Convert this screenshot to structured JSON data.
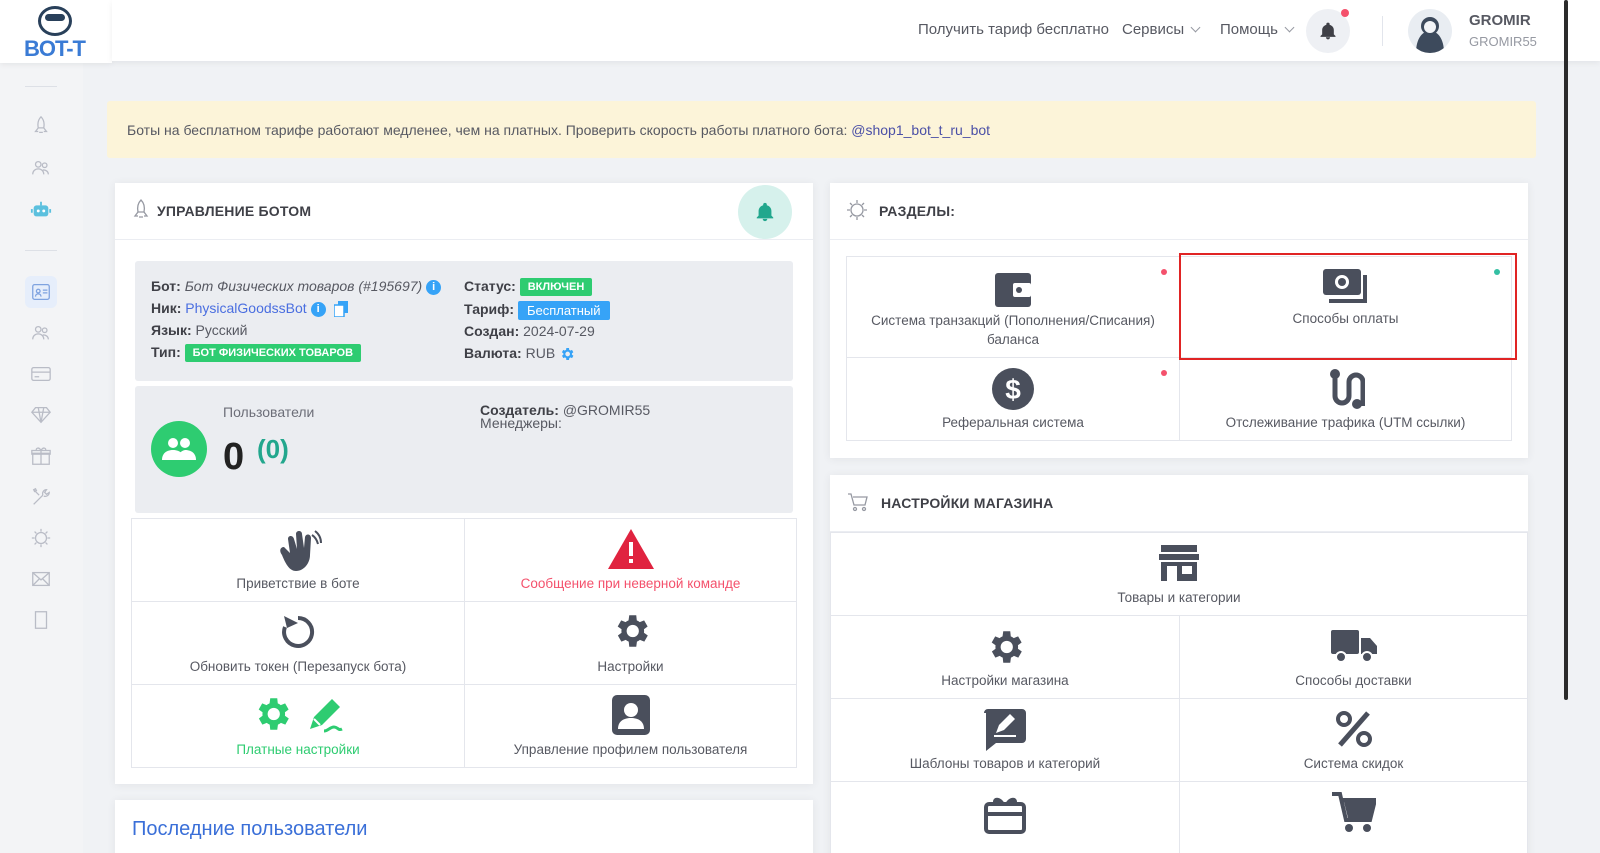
{
  "brand": {
    "logo_text": "BOT-T"
  },
  "topbar": {
    "free_plan_link": "Получить тариф бесплатно",
    "services_menu": "Сервисы",
    "help_menu": "Помощь",
    "user_name": "GROMIR",
    "user_login": "GROMIR55"
  },
  "alert": {
    "text": "Боты на бесплатном тарифе работают медленее, чем на платных. Проверить скорость работы платного бота: ",
    "link": "@shop1_bot_t_ru_bot"
  },
  "bot_panel": {
    "title": "УПРАВЛЕНИЕ БОТОМ",
    "bot_label": "Бот:",
    "bot_value": "Бот Физических товаров (#195697)",
    "nick_label": "Ник:",
    "nick_value": "PhysicalGoodssBot",
    "lang_label": "Язык:",
    "lang_value": "Русский",
    "type_label": "Тип:",
    "type_value": "БОТ ФИЗИЧЕСКИХ ТОВАРОВ",
    "status_label": "Статус:",
    "status_value": "ВКЛЮЧЕН",
    "tariff_label": "Тариф:",
    "tariff_value": "Бесплатный",
    "created_label": "Создан:",
    "created_value": "2024-07-29",
    "currency_label": "Валюта:",
    "currency_value": "RUB",
    "users_label": "Пользователи",
    "users_count": "0",
    "users_new": "(0)",
    "creator_label": "Создатель:",
    "creator_value": "@GROMIR55",
    "managers_label": "Менеджеры:",
    "actions": [
      {
        "label": "Приветствие в боте"
      },
      {
        "label": "Сообщение при неверной команде"
      },
      {
        "label": "Обновить токен (Перезапуск бота)"
      },
      {
        "label": "Настройки"
      },
      {
        "label": "Платные настройки"
      },
      {
        "label": "Управление профилем пользователя"
      }
    ]
  },
  "last_users": {
    "title": "Последние пользователи"
  },
  "sections": {
    "title": "РАЗДЕЛЫ:",
    "items": [
      {
        "label": "Система транзакций (Пополнения/Списания) баланса"
      },
      {
        "label": "Способы оплаты"
      },
      {
        "label": "Реферальная система"
      },
      {
        "label": "Отслеживание трафика (UTM ссылки)"
      }
    ]
  },
  "shop": {
    "title": "НАСТРОЙКИ МАГАЗИНА",
    "items": [
      {
        "label": "Товары и категории"
      },
      {
        "label": "Настройки магазина"
      },
      {
        "label": "Способы доставки"
      },
      {
        "label": "Шаблоны товаров и категорий"
      },
      {
        "label": "Система скидок"
      }
    ]
  },
  "colors": {
    "accent_green": "#2ecc71",
    "alert_bg": "#fcf4d9",
    "link_blue": "#4a6ee0",
    "danger": "#f4516c"
  }
}
